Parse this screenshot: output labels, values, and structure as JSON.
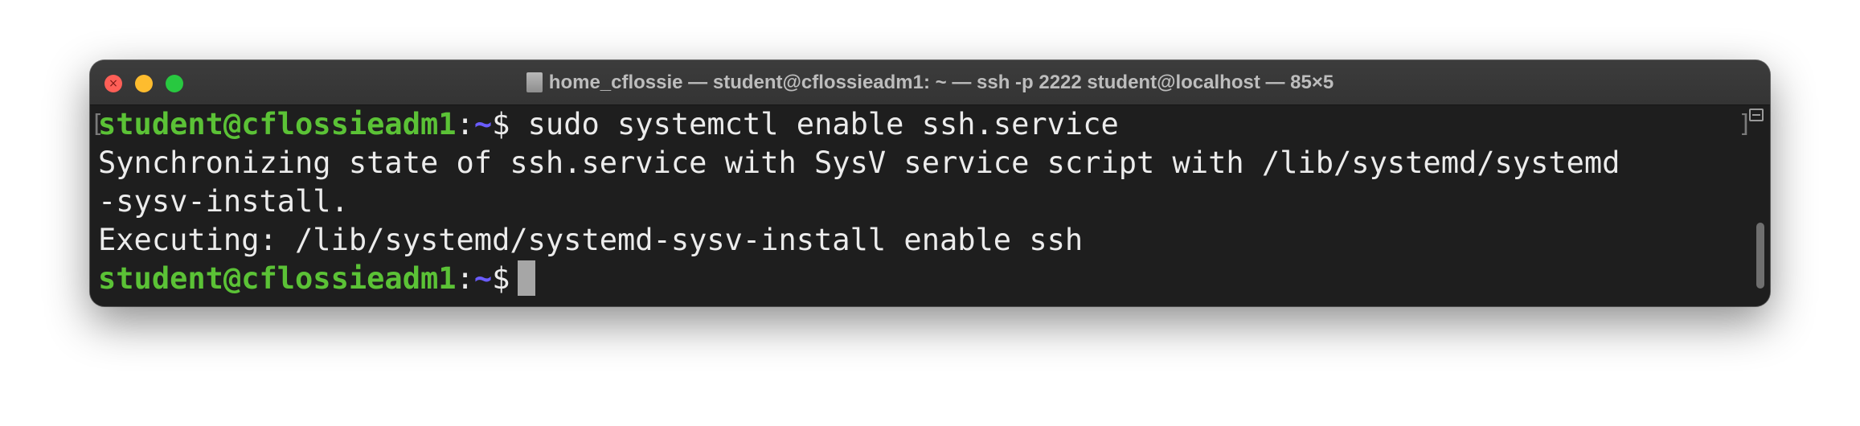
{
  "window": {
    "title": "home_cflossie — student@cflossieadm1: ~ — ssh -p 2222 student@localhost — 85×5",
    "title_icon": "document-icon",
    "traffic_lights": {
      "close_color": "#fe5f57",
      "minimize_color": "#febc2e",
      "zoom_color": "#28c840",
      "close_glyph": "×"
    }
  },
  "terminal": {
    "prompt_user_host": "student@cflossieadm1",
    "prompt_colon": ":",
    "prompt_path": "~",
    "prompt_symbol": "$",
    "line1_command": " sudo systemctl enable ssh.service",
    "line2": "Synchronizing state of ssh.service with SysV service script with /lib/systemd/systemd",
    "line3": "-sysv-install.",
    "line4": "Executing: /lib/systemd/systemd-sysv-install enable ssh",
    "colors": {
      "background": "#1e1e1e",
      "text": "#ececec",
      "prompt_user": "#5bc236",
      "prompt_path": "#6a5cff",
      "cursor": "#a6a6a6"
    },
    "left_mark": "[",
    "right_mark": "]"
  }
}
